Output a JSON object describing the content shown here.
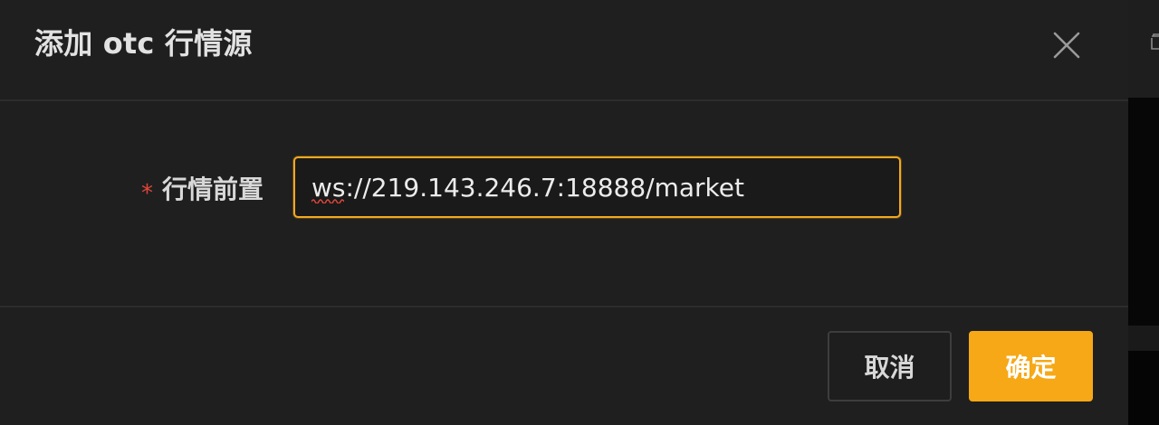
{
  "dialog": {
    "title": "添加 otc 行情源",
    "close_icon": "close-icon"
  },
  "form": {
    "field_label": "行情前置",
    "required_mark": "*",
    "field_value": "ws://219.143.246.7:18888/market"
  },
  "footer": {
    "cancel_label": "取消",
    "confirm_label": "确定"
  },
  "colors": {
    "accent": "#f6a817",
    "required": "#e0463a",
    "dialog_bg": "#1f1f1f"
  }
}
